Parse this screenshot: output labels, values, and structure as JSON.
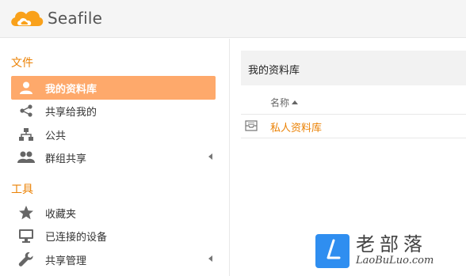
{
  "app": {
    "logo_text": "Seafile"
  },
  "sidebar": {
    "files_section": "文件",
    "tools_section": "工具",
    "items": [
      {
        "label": "我的资料库",
        "icon": "user-icon"
      },
      {
        "label": "共享给我的",
        "icon": "share-icon"
      },
      {
        "label": "公共",
        "icon": "org-tree-icon"
      },
      {
        "label": "群组共享",
        "icon": "group-icon"
      }
    ],
    "tools": [
      {
        "label": "收藏夹",
        "icon": "star-icon"
      },
      {
        "label": "已连接的设备",
        "icon": "monitor-icon"
      },
      {
        "label": "共享管理",
        "icon": "wrench-icon"
      }
    ]
  },
  "main": {
    "title": "我的资料库",
    "columns": {
      "name": "名称"
    },
    "repos": [
      {
        "name": "私人资料库",
        "icon": "library-icon"
      }
    ]
  },
  "watermark": {
    "cn": "老部落",
    "en": "LaoBuLuo.com"
  },
  "colors": {
    "accent": "#eb8205",
    "active_bg": "#fea96b",
    "watermark_blue": "#2f8ef0"
  }
}
